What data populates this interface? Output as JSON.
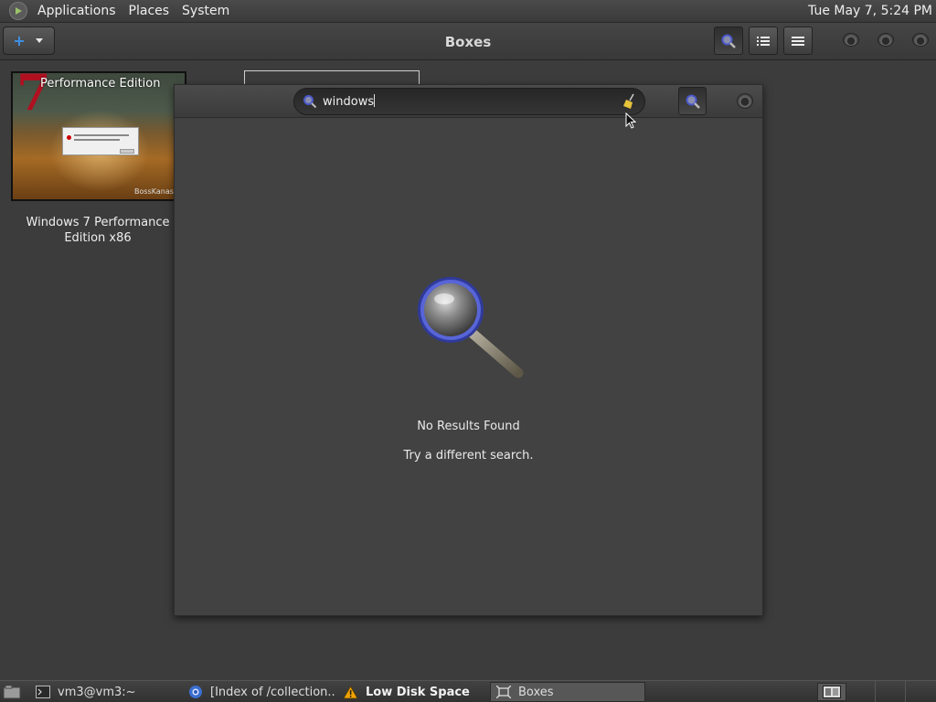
{
  "top_panel": {
    "menus": [
      "Applications",
      "Places",
      "System"
    ],
    "clock": "Tue May  7,  5:24 PM"
  },
  "toolbar": {
    "title": "Boxes"
  },
  "collection": {
    "vm": {
      "thumb_number": "7",
      "thumb_title": "Performance Edition",
      "thumb_watermark": "BossKanas R",
      "name": "Windows 7 Performance Edition x86"
    }
  },
  "search": {
    "value": "windows",
    "empty_title": "No Results Found",
    "empty_hint": "Try a different search."
  },
  "taskbar": {
    "items": [
      {
        "label": "vm3@vm3:~",
        "icon": "terminal-icon"
      },
      {
        "label": "[Index of /collection...",
        "icon": "browser-icon"
      },
      {
        "label": "Low Disk Space",
        "icon": "warning-icon"
      },
      {
        "label": "Boxes",
        "icon": "boxes-icon"
      }
    ]
  },
  "colors": {
    "background": "#3c3c3c",
    "accent_blue": "#4a57c8",
    "warning": "#f2a300"
  }
}
